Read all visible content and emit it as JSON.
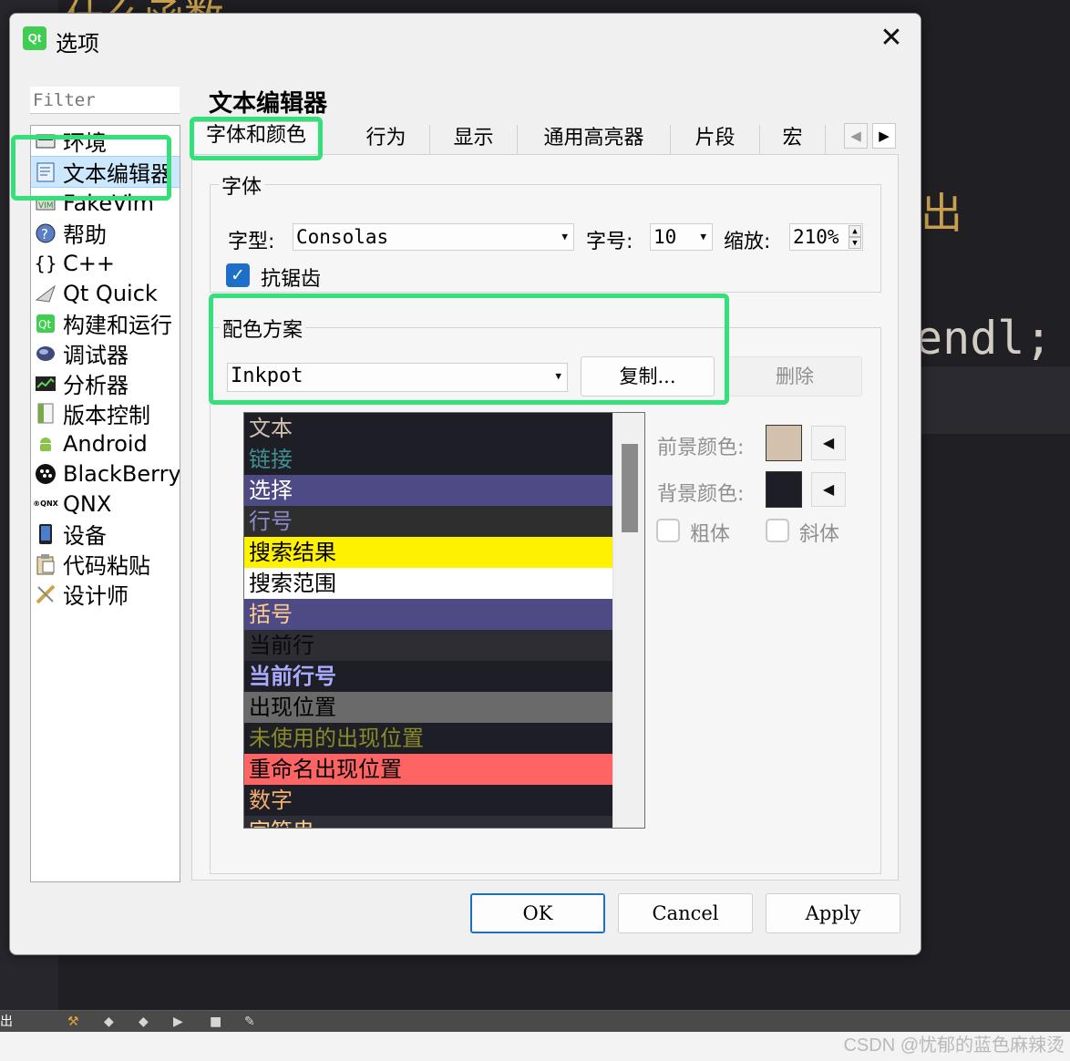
{
  "background": {
    "top_text": "什么函数",
    "right_text_1": "出",
    "right_text_2": "endl;",
    "statusbar_left_char": "出"
  },
  "watermark": "CSDN @忧郁的蓝色麻辣烫",
  "dialog": {
    "title": "选项",
    "logo_text": "Qt",
    "close_symbol": "✕",
    "filter_placeholder": "Filter",
    "page_title": "文本编辑器",
    "nav": [
      {
        "label": "环境",
        "icon": "environment-icon"
      },
      {
        "label": "文本编辑器",
        "icon": "text-editor-icon",
        "selected": true
      },
      {
        "label": "FakeVim",
        "icon": "fakevim-icon"
      },
      {
        "label": "帮助",
        "icon": "help-icon"
      },
      {
        "label": "C++",
        "icon": "cpp-braces-icon"
      },
      {
        "label": "Qt Quick",
        "icon": "qt-quick-icon"
      },
      {
        "label": "构建和运行",
        "icon": "build-run-icon"
      },
      {
        "label": "调试器",
        "icon": "debugger-icon"
      },
      {
        "label": "分析器",
        "icon": "analyzer-icon"
      },
      {
        "label": "版本控制",
        "icon": "version-control-icon"
      },
      {
        "label": "Android",
        "icon": "android-icon"
      },
      {
        "label": "BlackBerry",
        "icon": "blackberry-icon"
      },
      {
        "label": "QNX",
        "icon": "qnx-icon"
      },
      {
        "label": "设备",
        "icon": "device-icon"
      },
      {
        "label": "代码粘贴",
        "icon": "code-paste-icon"
      },
      {
        "label": "设计师",
        "icon": "designer-icon"
      }
    ],
    "tabs": [
      "字体和颜色",
      "行为",
      "显示",
      "通用高亮器",
      "片段",
      "宏"
    ],
    "font_group": {
      "title": "字体",
      "family_label": "字型:",
      "family_value": "Consolas",
      "size_label": "字号:",
      "size_value": "10",
      "zoom_label": "缩放:",
      "zoom_value": "210%",
      "antialias_label": "抗锯齿",
      "antialias_checked": true
    },
    "scheme_group": {
      "title": "配色方案",
      "value": "Inkpot",
      "copy_button": "复制...",
      "delete_button": "删除"
    },
    "color_items": [
      {
        "label": "文本",
        "fg": "#cfbfad",
        "bg": "#1e1e27",
        "bold": false
      },
      {
        "label": "链接",
        "fg": "#409090",
        "bg": "#1e1e27",
        "bold": false
      },
      {
        "label": "选择",
        "fg": "#ffffff",
        "bg": "#4e4a86",
        "bold": false
      },
      {
        "label": "行号",
        "fg": "#8b8bcd",
        "bg": "#2e2e2e",
        "bold": false
      },
      {
        "label": "搜索结果",
        "fg": "#000000",
        "bg": "#fff200",
        "bold": false
      },
      {
        "label": "搜索范围",
        "fg": "#000000",
        "bg": "#ffffff",
        "bold": false
      },
      {
        "label": "括号",
        "fg": "#ffcd8b",
        "bg": "#4e4a86",
        "bold": false
      },
      {
        "label": "当前行",
        "fg": "#0a0a0a",
        "bg": "#2d2d33",
        "bold": false
      },
      {
        "label": "当前行号",
        "fg": "#aaaaff",
        "bg": "#1e1e27",
        "bold": true
      },
      {
        "label": "出现位置",
        "fg": "#000000",
        "bg": "#6a6a6a",
        "bold": false
      },
      {
        "label": "未使用的出现位置",
        "fg": "#8a8a2a",
        "bg": "#1e1e27",
        "bold": false
      },
      {
        "label": "重命名出现位置",
        "fg": "#000000",
        "bg": "#ff6464",
        "bold": false
      },
      {
        "label": "数字",
        "fg": "#f0ad6d",
        "bg": "#1e1e27",
        "bold": false
      },
      {
        "label": "字符串",
        "fg": "#ffcd8b",
        "bg": "#2e2e38",
        "bold": false
      }
    ],
    "foreground_label": "前景颜色:",
    "foreground_color": "#d3c1ad",
    "background_label": "背景颜色:",
    "background_color": "#1e1e27",
    "bold_label": "粗体",
    "italic_label": "斜体",
    "buttons": {
      "ok": "OK",
      "cancel": "Cancel",
      "apply": "Apply"
    }
  }
}
